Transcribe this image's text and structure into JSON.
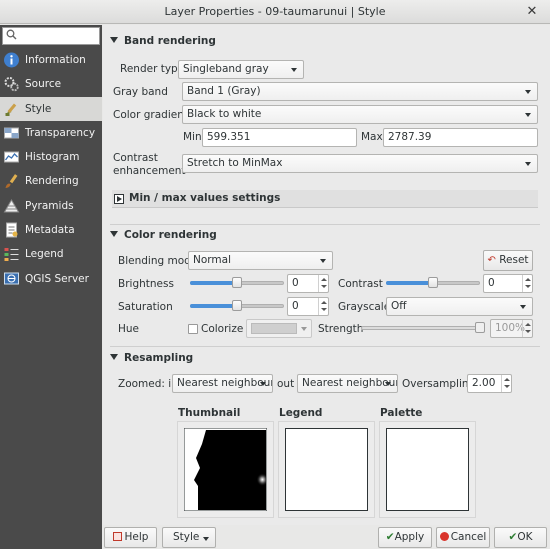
{
  "window": {
    "title": "Layer Properties - 09-taumarunui | Style"
  },
  "sidebar": {
    "search_placeholder": "",
    "items": [
      {
        "label": "Information",
        "icon": "information-icon"
      },
      {
        "label": "Source",
        "icon": "source-icon"
      },
      {
        "label": "Style",
        "icon": "style-icon",
        "active": true
      },
      {
        "label": "Transparency",
        "icon": "transparency-icon"
      },
      {
        "label": "Histogram",
        "icon": "histogram-icon"
      },
      {
        "label": "Rendering",
        "icon": "rendering-icon"
      },
      {
        "label": "Pyramids",
        "icon": "pyramids-icon"
      },
      {
        "label": "Metadata",
        "icon": "metadata-icon"
      },
      {
        "label": "Legend",
        "icon": "legend-icon"
      },
      {
        "label": "QGIS Server",
        "icon": "qgis-server-icon"
      }
    ]
  },
  "band": {
    "header": "Band rendering",
    "render_type_label": "Render type",
    "render_type": "Singleband gray",
    "gray_band_label": "Gray band",
    "gray_band": "Band 1 (Gray)",
    "gradient_label": "Color gradient",
    "gradient": "Black to white",
    "min_label": "Min",
    "min": "599.351",
    "max_label": "Max",
    "max": "2787.39",
    "contrast_label_1": "Contrast",
    "contrast_label_2": "enhancement",
    "contrast": "Stretch to MinMax",
    "minmax_settings": "Min / max values settings"
  },
  "color": {
    "header": "Color rendering",
    "blending_label": "Blending mode",
    "blending": "Normal",
    "reset": "Reset",
    "brightness_label": "Brightness",
    "brightness": "0",
    "contrast_label": "Contrast",
    "contrast": "0",
    "saturation_label": "Saturation",
    "saturation": "0",
    "grayscale_label": "Grayscale",
    "grayscale": "Off",
    "hue_label": "Hue",
    "colorize_label": "Colorize",
    "strength_label": "Strength",
    "strength": "100%"
  },
  "resampling": {
    "header": "Resampling",
    "zoomed_in_label": "Zoomed: in",
    "zoomed_in": "Nearest neighbour",
    "out_label": "out",
    "zoomed_out": "Nearest neighbour",
    "oversampling_label": "Oversampling",
    "oversampling": "2.00"
  },
  "preview": {
    "thumbnail_label": "Thumbnail",
    "legend_label": "Legend",
    "palette_label": "Palette"
  },
  "buttons": {
    "help": "Help",
    "style": "Style",
    "apply": "Apply",
    "cancel": "Cancel",
    "ok": "OK"
  }
}
